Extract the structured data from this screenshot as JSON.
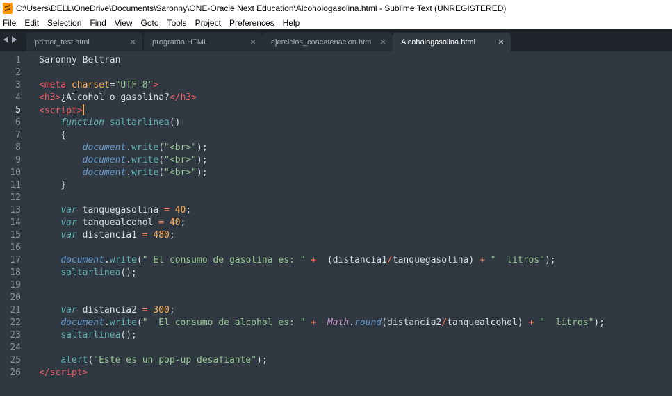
{
  "window": {
    "title": "C:\\Users\\DELL\\OneDrive\\Documents\\Saronny\\ONE-Oracle Next Education\\Alcohologasolina.html - Sublime Text (UNREGISTERED)",
    "app_icon": "sublime-text-icon"
  },
  "menu": [
    "File",
    "Edit",
    "Selection",
    "Find",
    "View",
    "Goto",
    "Tools",
    "Project",
    "Preferences",
    "Help"
  ],
  "tabs": [
    {
      "label": "primer_test.html",
      "active": false
    },
    {
      "label": "programa.HTML",
      "active": false
    },
    {
      "label": "ejercicios_concatenacion.html",
      "active": false
    },
    {
      "label": "Alcohologasolina.html",
      "active": true
    }
  ],
  "tab_close_glyph": "×",
  "editor": {
    "current_line": 5,
    "line_numbers": [
      "1",
      "2",
      "3",
      "4",
      "5",
      "6",
      "7",
      "8",
      "9",
      "10",
      "11",
      "12",
      "13",
      "14",
      "15",
      "16",
      "17",
      "18",
      "19",
      "20",
      "21",
      "22",
      "23",
      "24",
      "25",
      "26"
    ],
    "lines": [
      [
        {
          "t": "Saronny Beltran",
          "c": "text"
        }
      ],
      [],
      [
        {
          "t": "<",
          "c": "tag"
        },
        {
          "t": "meta",
          "c": "tag"
        },
        {
          "t": " charset",
          "c": "attr"
        },
        {
          "t": "=",
          "c": "punc"
        },
        {
          "t": "\"UTF-8\"",
          "c": "str"
        },
        {
          "t": ">",
          "c": "tag"
        }
      ],
      [
        {
          "t": "<",
          "c": "tag"
        },
        {
          "t": "h3",
          "c": "tag"
        },
        {
          "t": ">",
          "c": "tag"
        },
        {
          "t": "¿Alcohol o gasolina?",
          "c": "text"
        },
        {
          "t": "</",
          "c": "tag"
        },
        {
          "t": "h3",
          "c": "tag"
        },
        {
          "t": ">",
          "c": "tag"
        }
      ],
      [
        {
          "t": "<",
          "c": "tag"
        },
        {
          "t": "script",
          "c": "tag"
        },
        {
          "t": ">",
          "c": "tag"
        },
        {
          "t": "",
          "c": "cursor"
        }
      ],
      [
        {
          "t": "    ",
          "c": "text"
        },
        {
          "t": "function",
          "c": "kw"
        },
        {
          "t": " ",
          "c": "text"
        },
        {
          "t": "saltarlinea",
          "c": "fn"
        },
        {
          "t": "()",
          "c": "punc"
        }
      ],
      [
        {
          "t": "    {",
          "c": "punc"
        }
      ],
      [
        {
          "t": "        ",
          "c": "text"
        },
        {
          "t": "document",
          "c": "obj"
        },
        {
          "t": ".",
          "c": "punc"
        },
        {
          "t": "write",
          "c": "fn"
        },
        {
          "t": "(",
          "c": "punc"
        },
        {
          "t": "\"<br>\"",
          "c": "str"
        },
        {
          "t": ");",
          "c": "punc"
        }
      ],
      [
        {
          "t": "        ",
          "c": "text"
        },
        {
          "t": "document",
          "c": "obj"
        },
        {
          "t": ".",
          "c": "punc"
        },
        {
          "t": "write",
          "c": "fn"
        },
        {
          "t": "(",
          "c": "punc"
        },
        {
          "t": "\"<br>\"",
          "c": "str"
        },
        {
          "t": ");",
          "c": "punc"
        }
      ],
      [
        {
          "t": "        ",
          "c": "text"
        },
        {
          "t": "document",
          "c": "obj"
        },
        {
          "t": ".",
          "c": "punc"
        },
        {
          "t": "write",
          "c": "fn"
        },
        {
          "t": "(",
          "c": "punc"
        },
        {
          "t": "\"<br>\"",
          "c": "str"
        },
        {
          "t": ");",
          "c": "punc"
        }
      ],
      [
        {
          "t": "    }",
          "c": "punc"
        }
      ],
      [],
      [
        {
          "t": "    ",
          "c": "text"
        },
        {
          "t": "var",
          "c": "kw"
        },
        {
          "t": " tanquegasolina ",
          "c": "text"
        },
        {
          "t": "=",
          "c": "op"
        },
        {
          "t": " ",
          "c": "text"
        },
        {
          "t": "40",
          "c": "num"
        },
        {
          "t": ";",
          "c": "punc"
        }
      ],
      [
        {
          "t": "    ",
          "c": "text"
        },
        {
          "t": "var",
          "c": "kw"
        },
        {
          "t": " tanquealcohol ",
          "c": "text"
        },
        {
          "t": "=",
          "c": "op"
        },
        {
          "t": " ",
          "c": "text"
        },
        {
          "t": "40",
          "c": "num"
        },
        {
          "t": ";",
          "c": "punc"
        }
      ],
      [
        {
          "t": "    ",
          "c": "text"
        },
        {
          "t": "var",
          "c": "kw"
        },
        {
          "t": " distancia1 ",
          "c": "text"
        },
        {
          "t": "=",
          "c": "op"
        },
        {
          "t": " ",
          "c": "text"
        },
        {
          "t": "480",
          "c": "num"
        },
        {
          "t": ";",
          "c": "punc"
        }
      ],
      [],
      [
        {
          "t": "    ",
          "c": "text"
        },
        {
          "t": "document",
          "c": "obj"
        },
        {
          "t": ".",
          "c": "punc"
        },
        {
          "t": "write",
          "c": "fn"
        },
        {
          "t": "(",
          "c": "punc"
        },
        {
          "t": "\" El consumo de gasolina es: \"",
          "c": "str"
        },
        {
          "t": " ",
          "c": "text"
        },
        {
          "t": "+",
          "c": "op"
        },
        {
          "t": "  (distancia1",
          "c": "text"
        },
        {
          "t": "/",
          "c": "op"
        },
        {
          "t": "tanquegasolina) ",
          "c": "text"
        },
        {
          "t": "+",
          "c": "op"
        },
        {
          "t": " ",
          "c": "text"
        },
        {
          "t": "\"  litros\"",
          "c": "str"
        },
        {
          "t": ");",
          "c": "punc"
        }
      ],
      [
        {
          "t": "    ",
          "c": "text"
        },
        {
          "t": "saltarlinea",
          "c": "fn"
        },
        {
          "t": "();",
          "c": "punc"
        }
      ],
      [],
      [],
      [
        {
          "t": "    ",
          "c": "text"
        },
        {
          "t": "var",
          "c": "kw"
        },
        {
          "t": " distancia2 ",
          "c": "text"
        },
        {
          "t": "=",
          "c": "op"
        },
        {
          "t": " ",
          "c": "text"
        },
        {
          "t": "300",
          "c": "num"
        },
        {
          "t": ";",
          "c": "punc"
        }
      ],
      [
        {
          "t": "    ",
          "c": "text"
        },
        {
          "t": "document",
          "c": "obj"
        },
        {
          "t": ".",
          "c": "punc"
        },
        {
          "t": "write",
          "c": "fn"
        },
        {
          "t": "(",
          "c": "punc"
        },
        {
          "t": "\"  El consumo de alcohol es: \"",
          "c": "str"
        },
        {
          "t": " ",
          "c": "text"
        },
        {
          "t": "+",
          "c": "op"
        },
        {
          "t": "  ",
          "c": "text"
        },
        {
          "t": "Math",
          "c": "math"
        },
        {
          "t": ".",
          "c": "punc"
        },
        {
          "t": "round",
          "c": "round"
        },
        {
          "t": "(distancia2",
          "c": "text"
        },
        {
          "t": "/",
          "c": "op"
        },
        {
          "t": "tanquealcohol) ",
          "c": "text"
        },
        {
          "t": "+",
          "c": "op"
        },
        {
          "t": " ",
          "c": "text"
        },
        {
          "t": "\"  litros\"",
          "c": "str"
        },
        {
          "t": ");",
          "c": "punc"
        }
      ],
      [
        {
          "t": "    ",
          "c": "text"
        },
        {
          "t": "saltarlinea",
          "c": "fn"
        },
        {
          "t": "();",
          "c": "punc"
        }
      ],
      [],
      [
        {
          "t": "    ",
          "c": "text"
        },
        {
          "t": "alert",
          "c": "fn"
        },
        {
          "t": "(",
          "c": "punc"
        },
        {
          "t": "\"Este es un pop-up desafiante\"",
          "c": "str"
        },
        {
          "t": ");",
          "c": "punc"
        }
      ],
      [
        {
          "t": "</",
          "c": "tag"
        },
        {
          "t": "script",
          "c": "tag"
        },
        {
          "t": ">",
          "c": "tag"
        }
      ]
    ]
  }
}
